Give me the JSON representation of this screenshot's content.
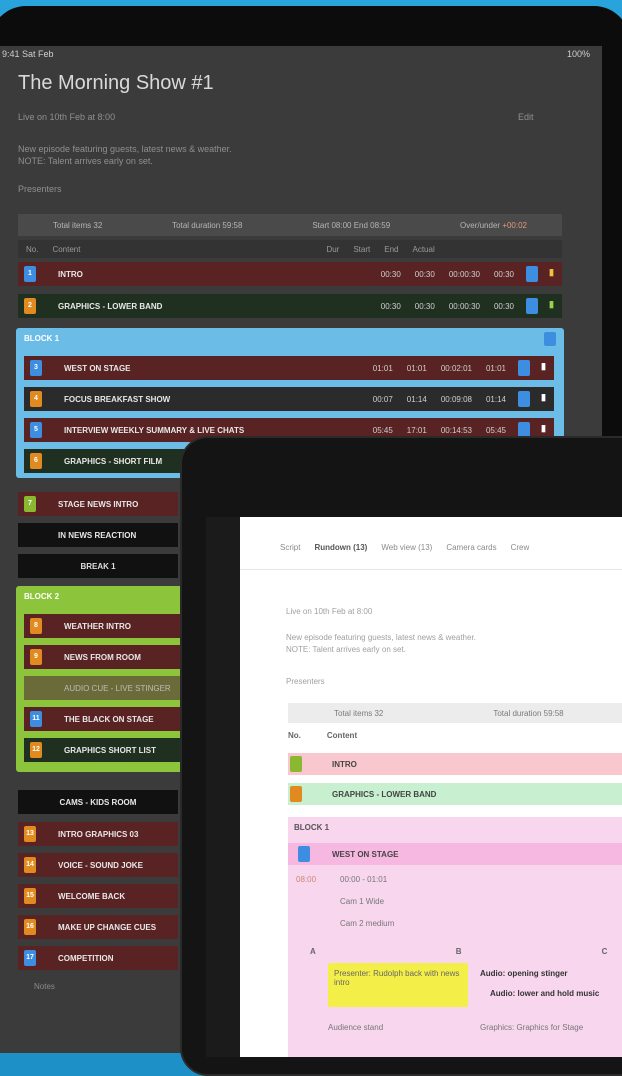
{
  "back": {
    "status_left": "9:41  Sat Feb",
    "status_right": "100%",
    "title": "The Morning Show #1",
    "meta1": "Live on 10th Feb at 8:00",
    "meta2": "New episode featuring guests, latest news & weather.",
    "meta3": "NOTE: Talent arrives early on set.",
    "meta4": "Presenters",
    "edit_label": "Edit",
    "stats": {
      "items_label": "Total items 32",
      "duration_label": "Total duration 59:58",
      "time_label": "Start 08:00  End 08:59",
      "over_label": "Over/under",
      "over_value": "+00:02"
    },
    "col_head": [
      "No.",
      "Content",
      "Dur",
      "Start",
      "End",
      "Actual"
    ],
    "rows": [
      {
        "badge": "1",
        "label": "INTRO",
        "nums": [
          "00:30",
          "00:30",
          "00:00:30",
          "00:30"
        ]
      },
      {
        "badge": "2",
        "label": "GRAPHICS - LOWER BAND",
        "nums": [
          "00:30",
          "00:30",
          "00:00:30",
          "00:30"
        ]
      },
      {
        "badge": "3",
        "label": "WEST ON STAGE",
        "nums": [
          "01:01",
          "01:01",
          "00:02:01",
          "01:01"
        ]
      },
      {
        "badge": "4",
        "label": "FOCUS BREAKFAST SHOW",
        "nums": [
          "00:07",
          "01:14",
          "00:09:08",
          "01:14"
        ]
      },
      {
        "badge": "5",
        "label": "INTERVIEW WEEKLY SUMMARY & LIVE CHATS",
        "nums": [
          "05:45",
          "17:01",
          "00:14:53",
          "05:45"
        ]
      },
      {
        "badge": "6",
        "label": "GRAPHICS - SHORT FILM",
        "nums": []
      },
      {
        "badge": "7",
        "label": "STAGE NEWS INTRO",
        "nums": []
      },
      {
        "badge": "",
        "label": "IN NEWS REACTION",
        "nums": []
      },
      {
        "badge": "",
        "label": "BREAK 1",
        "nums": []
      },
      {
        "badge": "8",
        "label": "WEATHER INTRO",
        "nums": []
      },
      {
        "badge": "9",
        "label": "NEWS FROM ROOM",
        "nums": []
      },
      {
        "badge": "10",
        "label": "AUDIO CUE - LIVE STINGER",
        "nums": []
      },
      {
        "badge": "11",
        "label": "THE BLACK ON STAGE",
        "nums": []
      },
      {
        "badge": "12",
        "label": "GRAPHICS SHORT LIST",
        "nums": []
      },
      {
        "badge": "",
        "label": "CAMS - KIDS ROOM",
        "nums": []
      },
      {
        "badge": "13",
        "label": "INTRO GRAPHICS 03",
        "nums": []
      },
      {
        "badge": "14",
        "label": "VOICE - SOUND JOKE",
        "nums": []
      },
      {
        "badge": "15",
        "label": "WELCOME BACK",
        "nums": []
      },
      {
        "badge": "16",
        "label": "MAKE UP CHANGE CUES",
        "nums": []
      },
      {
        "badge": "17",
        "label": "COMPETITION",
        "nums": []
      }
    ],
    "group1_label": "BLOCK 1",
    "group2_label": "BLOCK 2",
    "footer_label": "Notes"
  },
  "front": {
    "tabs": [
      "Script",
      "Rundown (13)",
      "Web view (13)",
      "Camera cards",
      "Crew"
    ],
    "meta1": "Live on 10th Feb at 8:00",
    "meta2": "New episode featuring guests, latest news & weather.",
    "meta3": "NOTE: Talent arrives early on set.",
    "meta4": "Presenters",
    "stats_items": "Total items 32",
    "stats_duration": "Total duration 59:58",
    "col_head": [
      "No.",
      "Content"
    ],
    "rows": [
      {
        "label": "INTRO"
      },
      {
        "label": "GRAPHICS - LOWER BAND"
      },
      {
        "label": "WEST ON STAGE"
      }
    ],
    "block_label": "BLOCK 1",
    "sub_time": "08:00",
    "sub_items": [
      "00:00 - 01:01",
      "Cam 1 Wide",
      "Cam 2 medium"
    ],
    "script_cols": [
      "A",
      "B",
      "C"
    ],
    "yellow_note": "Presenter: Rudolph back with news intro",
    "bold_lines": [
      "Audio: opening stinger",
      "Audio: lower and hold music"
    ],
    "bottom_left": "Audience stand",
    "bottom_right": "Graphics: Graphics for Stage"
  }
}
